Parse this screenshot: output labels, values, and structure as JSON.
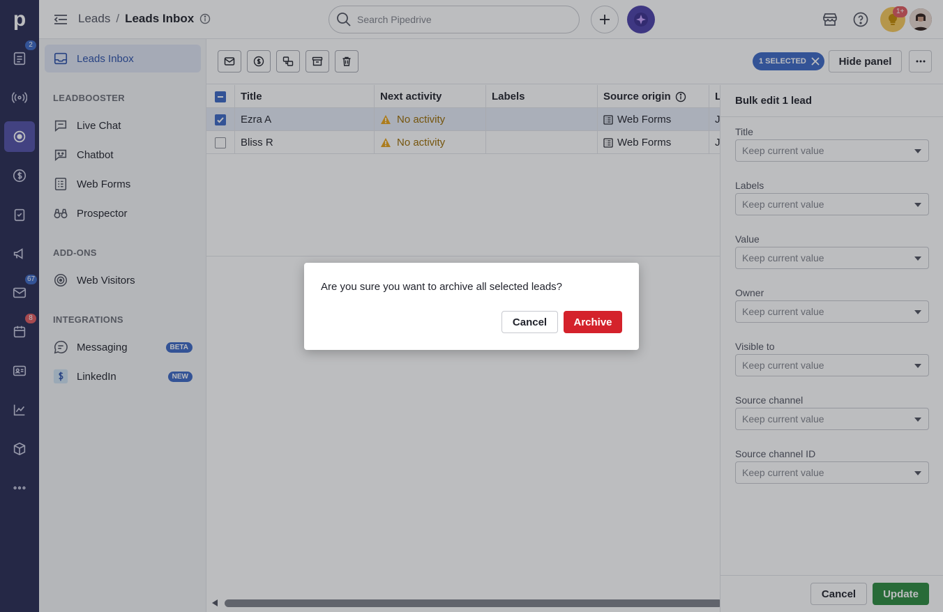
{
  "rail": {
    "logo": "p",
    "items": [
      {
        "icon": "leads-icon",
        "badge": "2"
      },
      {
        "icon": "broadcast-icon",
        "badge": ""
      },
      {
        "icon": "target-icon",
        "badge": ""
      },
      {
        "icon": "dollar-icon",
        "badge": ""
      },
      {
        "icon": "clipboard-icon",
        "badge": ""
      },
      {
        "icon": "megaphone-icon",
        "badge": ""
      },
      {
        "icon": "mail-icon",
        "badge": "67"
      },
      {
        "icon": "calendar-icon",
        "badge": "8"
      },
      {
        "icon": "contacts-icon",
        "badge": ""
      },
      {
        "icon": "chart-icon",
        "badge": ""
      },
      {
        "icon": "box-icon",
        "badge": ""
      },
      {
        "icon": "more-icon",
        "badge": ""
      }
    ]
  },
  "topbar": {
    "breadcrumb_parent": "Leads",
    "breadcrumb_sep": "/",
    "breadcrumb_current": "Leads Inbox",
    "search_placeholder": "Search Pipedrive",
    "notif_badge": "1+"
  },
  "sidenav": {
    "inbox_label": "Leads Inbox",
    "section_leadbooster": "LEADBOOSTER",
    "live_chat": "Live Chat",
    "chatbot": "Chatbot",
    "web_forms": "Web Forms",
    "prospector": "Prospector",
    "section_addons": "ADD-ONS",
    "web_visitors": "Web Visitors",
    "section_integrations": "INTEGRATIONS",
    "messaging": "Messaging",
    "messaging_pill": "BETA",
    "linkedin": "LinkedIn",
    "linkedin_pill": "NEW"
  },
  "toolbar": {
    "selected_label": "1 SELECTED",
    "hide_panel": "Hide panel"
  },
  "table": {
    "headers": [
      "Title",
      "Next activity",
      "Labels",
      "Source origin",
      "L"
    ],
    "rows": [
      {
        "title": "Ezra A",
        "activity": "No activity",
        "labels": "",
        "source": "Web Forms",
        "extra": "J",
        "selected": true
      },
      {
        "title": "Bliss R",
        "activity": "No activity",
        "labels": "",
        "source": "Web Forms",
        "extra": "J",
        "selected": false
      }
    ]
  },
  "panel": {
    "title": "Bulk edit 1 lead",
    "fields": [
      {
        "label": "Title",
        "value": "Keep current value"
      },
      {
        "label": "Labels",
        "value": "Keep current value"
      },
      {
        "label": "Value",
        "value": "Keep current value"
      },
      {
        "label": "Owner",
        "value": "Keep current value"
      },
      {
        "label": "Visible to",
        "value": "Keep current value"
      },
      {
        "label": "Source channel",
        "value": "Keep current value"
      },
      {
        "label": "Source channel ID",
        "value": "Keep current value"
      }
    ],
    "cancel": "Cancel",
    "update": "Update"
  },
  "modal": {
    "message": "Are you sure you want to archive all selected leads?",
    "cancel": "Cancel",
    "archive": "Archive"
  }
}
